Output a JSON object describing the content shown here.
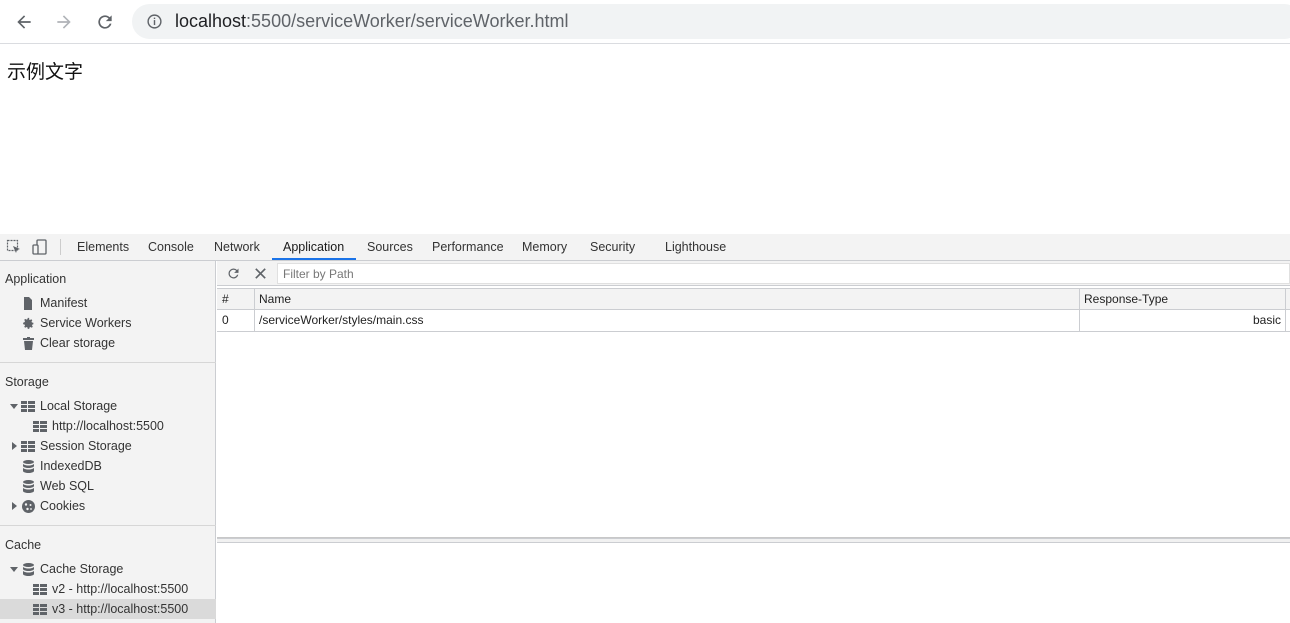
{
  "browser": {
    "url_host": "localhost",
    "url_rest": ":5500/serviceWorker/serviceWorker.html"
  },
  "page": {
    "text": "示例文字"
  },
  "devtools": {
    "tabs": [
      "Elements",
      "Console",
      "Network",
      "Application",
      "Sources",
      "Performance",
      "Memory",
      "Security",
      "Lighthouse"
    ],
    "active_tab": "Application",
    "accent_color": "#1a73e8",
    "sidebar": {
      "application": {
        "heading": "Application",
        "items": [
          "Manifest",
          "Service Workers",
          "Clear storage"
        ]
      },
      "storage": {
        "heading": "Storage",
        "local_storage": "Local Storage",
        "local_storage_child": "http://localhost:5500",
        "session_storage": "Session Storage",
        "indexeddb": "IndexedDB",
        "websql": "Web SQL",
        "cookies": "Cookies"
      },
      "cache": {
        "heading": "Cache",
        "cache_storage": "Cache Storage",
        "children": [
          "v2 - http://localhost:5500",
          "v3 - http://localhost:5500"
        ],
        "selected_index": 1
      }
    },
    "main": {
      "filter_placeholder": "Filter by Path",
      "columns": [
        "#",
        "Name",
        "Response-Type"
      ],
      "rows": [
        {
          "index": "0",
          "name": "/serviceWorker/styles/main.css",
          "response_type": "basic"
        }
      ]
    }
  }
}
